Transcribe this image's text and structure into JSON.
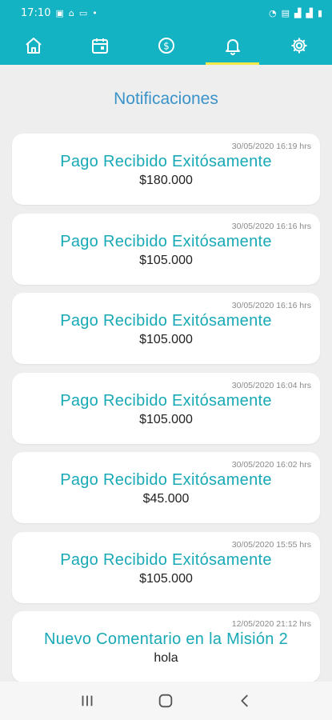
{
  "status_bar": {
    "time": "17:10",
    "icons": [
      "image-icon",
      "home-icon",
      "cast-icon",
      "dot-icon",
      "wifi-icon",
      "volte-icon",
      "signal-icon",
      "signal-icon",
      "battery-icon"
    ]
  },
  "nav": {
    "items": [
      {
        "name": "home-icon",
        "active": false
      },
      {
        "name": "calendar-icon",
        "active": false
      },
      {
        "name": "money-icon",
        "active": false
      },
      {
        "name": "bell-icon",
        "active": true
      },
      {
        "name": "gear-icon",
        "active": false
      }
    ],
    "accent": "#14b3c4",
    "active_indicator": "#f5e94a"
  },
  "page": {
    "title": "Notificaciones"
  },
  "notifications": [
    {
      "timestamp": "30/05/2020 16:19 hrs",
      "title": "Pago Recibido Exitósamente",
      "body": "$180.000"
    },
    {
      "timestamp": "30/05/2020 16:16 hrs",
      "title": "Pago Recibido Exitósamente",
      "body": "$105.000"
    },
    {
      "timestamp": "30/05/2020 16:16 hrs",
      "title": "Pago Recibido Exitósamente",
      "body": "$105.000"
    },
    {
      "timestamp": "30/05/2020 16:04 hrs",
      "title": "Pago Recibido Exitósamente",
      "body": "$105.000"
    },
    {
      "timestamp": "30/05/2020 16:02 hrs",
      "title": "Pago Recibido Exitósamente",
      "body": "$45.000"
    },
    {
      "timestamp": "30/05/2020 15:55 hrs",
      "title": "Pago Recibido Exitósamente",
      "body": "$105.000"
    },
    {
      "timestamp": "12/05/2020 21:12 hrs",
      "title": "Nuevo Comentario en la Misión 2",
      "body": "hola"
    }
  ],
  "system_nav": {
    "items": [
      "recents-icon",
      "home-button-icon",
      "back-icon"
    ]
  }
}
